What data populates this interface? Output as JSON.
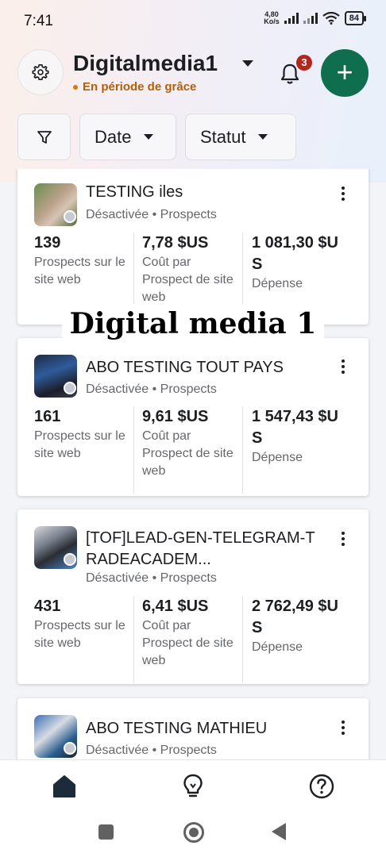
{
  "status_bar": {
    "time": "7:41",
    "speed_top": "4,80",
    "speed_unit": "Ko/s",
    "battery": "84"
  },
  "header": {
    "account_name": "Digitalmedia1",
    "grace_text": "En période de grâce",
    "notification_count": "3",
    "add_label": "+"
  },
  "filters": {
    "date_label": "Date",
    "status_label": "Statut"
  },
  "campaigns": [
    {
      "title": "TESTING iles",
      "status": "Désactivée",
      "objective": "Prospects",
      "metrics": [
        {
          "value": "139",
          "label": "Prospects sur le site web"
        },
        {
          "value": "7,78 $US",
          "label": "Coût par Prospect de site web"
        },
        {
          "value": "1 081,30 $US",
          "label": "Dépense"
        }
      ]
    },
    {
      "title": "ABO TESTING TOUT PAYS",
      "status": "Désactivée",
      "objective": "Prospects",
      "metrics": [
        {
          "value": "161",
          "label": "Prospects sur le site web"
        },
        {
          "value": "9,61 $US",
          "label": "Coût par Prospect de site web"
        },
        {
          "value": "1 547,43 $US",
          "label": "Dépense"
        }
      ]
    },
    {
      "title": "[TOF]LEAD-GEN-TELEGRAM-TRADEACADEM...",
      "status": "Désactivée",
      "objective": "Prospects",
      "metrics": [
        {
          "value": "431",
          "label": "Prospects sur le site web"
        },
        {
          "value": "6,41 $US",
          "label": "Coût par Prospect de site web"
        },
        {
          "value": "2 762,49 $US",
          "label": "Dépense"
        }
      ]
    },
    {
      "title": "ABO TESTING MATHIEU",
      "status": "Désactivée",
      "objective": "Prospects"
    }
  ],
  "separator": "•",
  "watermark": "Digital media 1",
  "bottom_nav": [
    "home-icon",
    "lightbulb-icon",
    "help-icon"
  ],
  "colors": {
    "accent_green": "#0e6e4d",
    "grace_orange": "#b45f06",
    "badge_red": "#b3261e"
  }
}
